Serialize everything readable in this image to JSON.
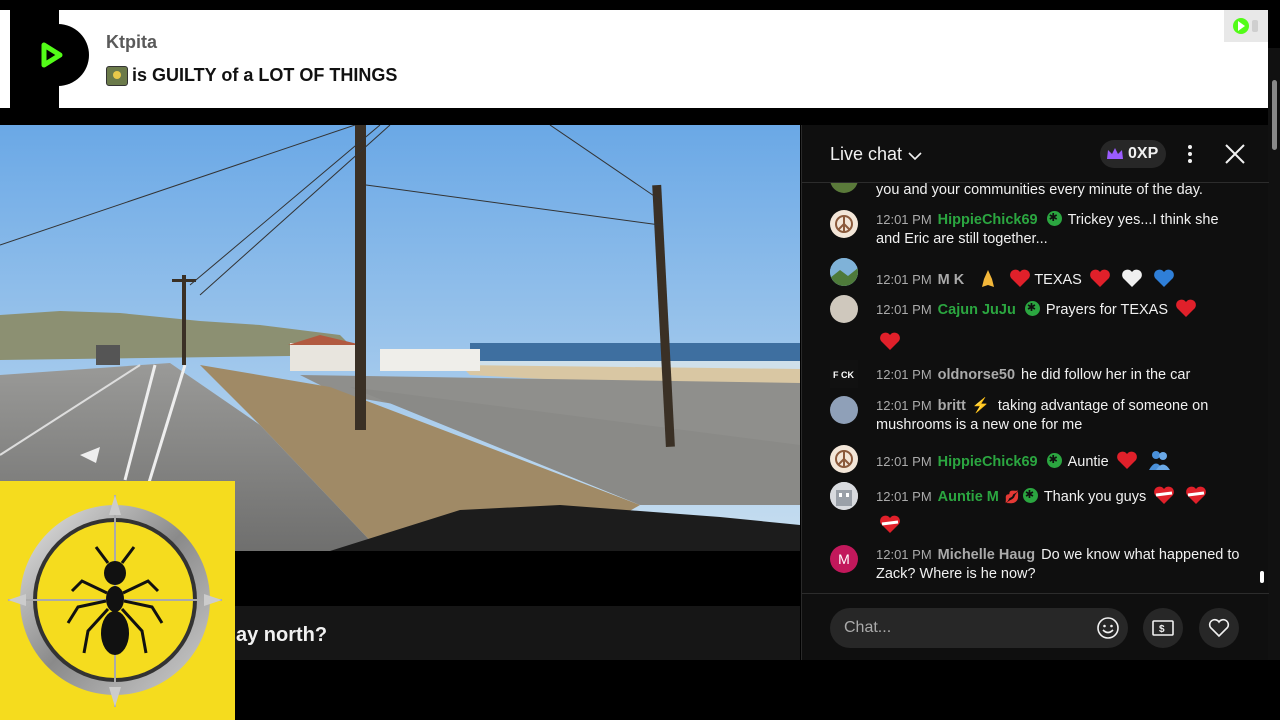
{
  "banner": {
    "username": "Ktpita",
    "message": "is GUILTY of a LOT OF THINGS"
  },
  "video": {
    "title_fragment": "ay north?"
  },
  "chat": {
    "title": "Live chat",
    "xp": "0XP",
    "input_placeholder": "Chat...",
    "messages": [
      {
        "time": "",
        "author": "",
        "text": "you and your communities every minute of the day."
      },
      {
        "time": "12:01 PM",
        "author": "HippieChick69",
        "text": "Trickey yes...I think she and Eric are still together..."
      },
      {
        "time": "12:01 PM",
        "author": "M K",
        "text": "TEXAS"
      },
      {
        "time": "12:01 PM",
        "author": "Cajun JuJu",
        "text": "Prayers for TEXAS"
      },
      {
        "time": "12:01 PM",
        "author": "oldnorse50",
        "text": "he did follow her in the car"
      },
      {
        "time": "12:01 PM",
        "author": "britt",
        "text": "taking advantage of someone on mushrooms is a new one for me"
      },
      {
        "time": "12:01 PM",
        "author": "HippieChick69",
        "text": "Auntie"
      },
      {
        "time": "12:01 PM",
        "author": "Auntie M",
        "text": "Thank you guys"
      },
      {
        "time": "12:01 PM",
        "author": "Michelle Haug",
        "text": "Do we know what happened to Zack? Where is he now?",
        "avatar_letter": "M"
      }
    ]
  },
  "colors": {
    "moderator_green": "#2ba640",
    "heart_red": "#e0202a",
    "ant_background": "#f5dc1e",
    "brand_green": "#53fc18"
  },
  "icons": [
    "kick-logo-icon",
    "chevron-down-icon",
    "crown-icon",
    "more-vert-icon",
    "close-icon",
    "emoji-icon",
    "dollar-icon",
    "heart-icon",
    "ant-crosshair-logo"
  ]
}
